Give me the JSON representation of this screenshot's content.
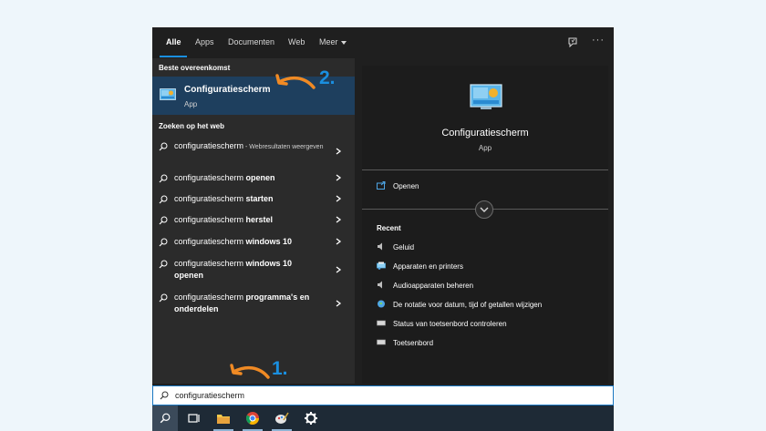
{
  "tabs": [
    {
      "label": "Alle"
    },
    {
      "label": "Apps"
    },
    {
      "label": "Documenten"
    },
    {
      "label": "Web"
    },
    {
      "label": "Meer"
    }
  ],
  "left": {
    "best_match_heading": "Beste overeenkomst",
    "best_match": {
      "title": "Configuratiescherm",
      "subtitle": "App",
      "icon": "control-panel-icon"
    },
    "web_heading": "Zoeken op het web",
    "web_results": [
      {
        "prefix": "configuratiescherm",
        "bold": "",
        "suffix": " - Webresultaten weergeven"
      },
      {
        "prefix": "configuratiescherm ",
        "bold": "openen",
        "suffix": ""
      },
      {
        "prefix": "configuratiescherm ",
        "bold": "starten",
        "suffix": ""
      },
      {
        "prefix": "configuratiescherm ",
        "bold": "herstel",
        "suffix": ""
      },
      {
        "prefix": "configuratiescherm ",
        "bold": "windows 10",
        "suffix": ""
      },
      {
        "prefix": "configuratiescherm ",
        "bold": "windows 10 openen",
        "suffix": ""
      },
      {
        "prefix": "configuratiescherm ",
        "bold": "programma's en onderdelen",
        "suffix": ""
      }
    ]
  },
  "right": {
    "title": "Configuratiescherm",
    "subtitle": "App",
    "open_label": "Openen",
    "recent_heading": "Recent",
    "recent": [
      {
        "label": "Geluid",
        "icon": "speaker-icon"
      },
      {
        "label": "Apparaten en printers",
        "icon": "devices-printers-icon"
      },
      {
        "label": "Audioapparaten beheren",
        "icon": "speaker-icon"
      },
      {
        "label": "De notatie voor datum, tijd of getallen wijzigen",
        "icon": "region-globe-icon"
      },
      {
        "label": "Status van toetsenbord controleren",
        "icon": "keyboard-icon"
      },
      {
        "label": "Toetsenbord",
        "icon": "keyboard-icon"
      }
    ]
  },
  "search": {
    "value": "configuratiescherm"
  },
  "annotations": {
    "step1": "1.",
    "step2": "2."
  },
  "colors": {
    "accent": "#1a8fe0",
    "arrow": "#f08a24",
    "selected": "#1e3f5e"
  }
}
